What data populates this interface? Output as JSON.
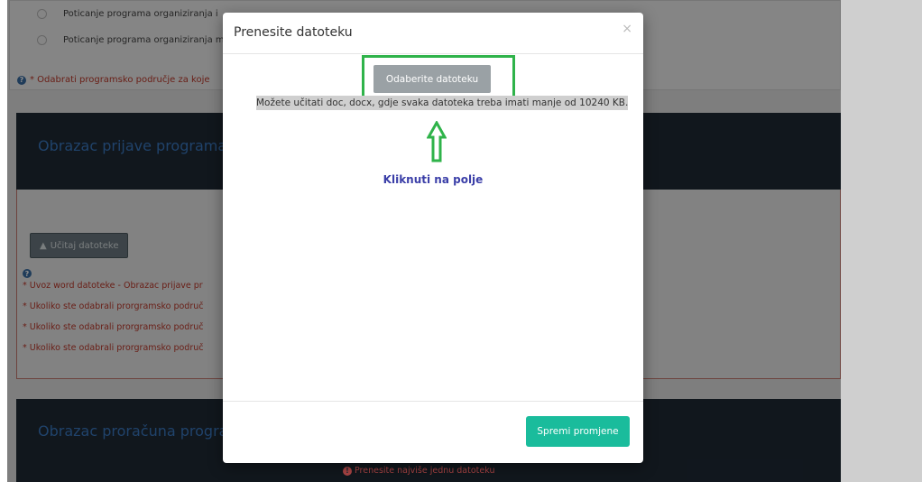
{
  "background": {
    "radio_options": [
      {
        "label": "Poticanje programa organiziranja i"
      },
      {
        "label": "Poticanje programa organiziranja m"
      }
    ],
    "programme_note": "* Odabrati programsko područje za koje",
    "section1_title": "Obrazac prijave programa:",
    "upload_button_label": "Učitaj datoteke",
    "red_notes": [
      "* Uvoz word datoteke - Obrazac prijave pr",
      "* Ukoliko ste odabrali prorgramsko područ",
      "* Ukoliko ste odabrali prorgramsko područ",
      "* Ukoliko ste odabrali prorgramsko područ"
    ],
    "section2_title": "Obrazac proračuna prograr",
    "bottom_error": "Prenesite najviše jednu datoteku"
  },
  "modal": {
    "title": "Prenesite datoteku",
    "close_symbol": "×",
    "choose_button_label": "Odaberite datoteku",
    "hint_text": "Možete učitati doc, docx, gdje svaka datoteka treba imati manje od 10240 KB.",
    "annotation_label": "Kliknuti na polje",
    "save_button_label": "Spremi promjene"
  },
  "colors": {
    "highlight": "#2fb34a",
    "annotation_text": "#3b3fa8",
    "save_button": "#1abc9c",
    "dark_header": "#1f2a36",
    "error_red": "#c0392b"
  },
  "icons": {
    "upload": "upload-icon",
    "question": "question-circle-icon",
    "annotation_arrow": "arrow-up-outline-icon",
    "error": "exclamation-circle-icon"
  }
}
